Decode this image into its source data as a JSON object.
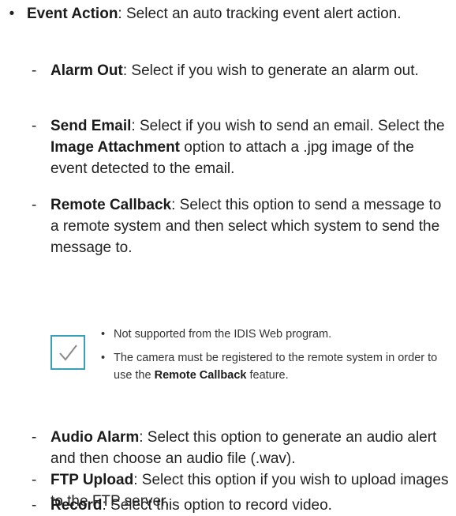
{
  "event_action": {
    "bullet": "•",
    "label": "Event Action",
    "text": ": Select an auto tracking event alert action.",
    "items": [
      {
        "dash": "-",
        "label": "Alarm Out",
        "text": ": Select if you wish to generate an alarm out."
      },
      {
        "dash": "-",
        "label": "Send Email",
        "text": ": Select if you wish to send an email. Select the ",
        "label2": "Image Attachment",
        "text2": " option to attach a .jpg image of the event detected to the email."
      },
      {
        "dash": "-",
        "label": "Remote Callback",
        "text": ": Select this option to send a message to a remote system and then select which system to send the message to."
      },
      {
        "dash": "-",
        "label": "Audio Alarm",
        "text": ": Select this option to generate an audio alert and then choose an audio file (.wav)."
      },
      {
        "dash": "-",
        "label": "FTP Upload",
        "text": ": Select this option if you wish to upload images to the FTP server."
      },
      {
        "dash": "-",
        "label": "Record",
        "text": ": Select this option to record video."
      }
    ]
  },
  "note": {
    "icon": "checkmark-icon",
    "accent_color": "#3aa0b8",
    "bullet": "•",
    "item1": "Not supported from the IDIS Web program.",
    "item2_pre": "The camera must be registered to the remote system in order to use the ",
    "item2_bold": "Remote Callback",
    "item2_post": " feature."
  }
}
